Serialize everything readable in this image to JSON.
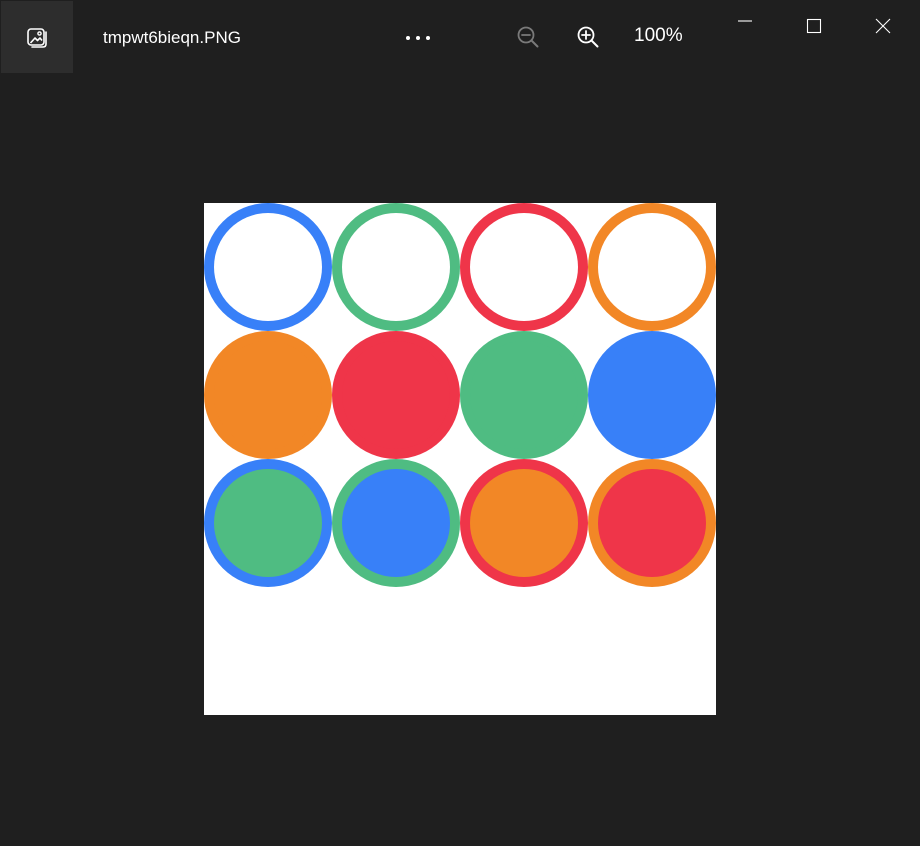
{
  "titlebar": {
    "file_name": "tmpwt6bieqn.PNG",
    "zoom_level": "100%",
    "icons": {
      "app": "photos-app-icon",
      "more": "more-options-icon",
      "zoom_out": "zoom-out-icon",
      "zoom_in": "zoom-in-icon",
      "minimize": "minimize-icon",
      "maximize": "maximize-icon",
      "close": "close-icon"
    }
  },
  "image": {
    "colors": {
      "blue": "#3880f8",
      "green": "#4fbc82",
      "red": "#ef3549",
      "orange": "#f28726"
    },
    "grid": {
      "columns": 4,
      "rows": [
        [
          {
            "ring": "blue",
            "fill": "white"
          },
          {
            "ring": "green",
            "fill": "white"
          },
          {
            "ring": "red",
            "fill": "white"
          },
          {
            "ring": "orange",
            "fill": "white"
          }
        ],
        [
          {
            "ring": "orange",
            "fill": "orange"
          },
          {
            "ring": "red",
            "fill": "red"
          },
          {
            "ring": "green",
            "fill": "green"
          },
          {
            "ring": "blue",
            "fill": "blue"
          }
        ],
        [
          {
            "ring": "blue",
            "fill": "green"
          },
          {
            "ring": "green",
            "fill": "blue"
          },
          {
            "ring": "red",
            "fill": "orange"
          },
          {
            "ring": "orange",
            "fill": "red"
          }
        ]
      ]
    }
  }
}
